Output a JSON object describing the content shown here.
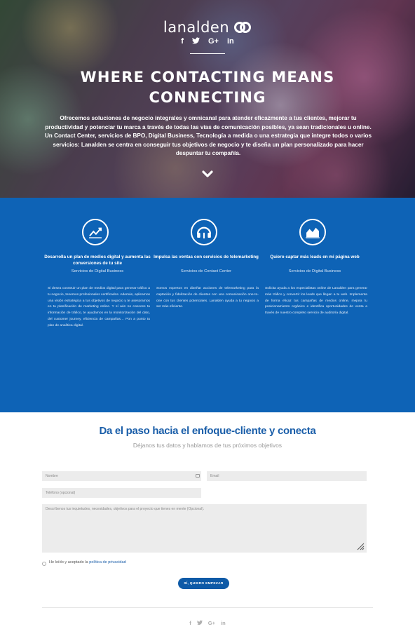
{
  "brand": {
    "name": "lanalden",
    "logo_icon": "double-ring-logo"
  },
  "hero": {
    "social": [
      "f",
      "🐦",
      "G+",
      "in"
    ],
    "title": "WHERE CONTACTING MEANS CONNECTING",
    "description": "Ofrecemos soluciones de negocio integrales y omnicanal para atender eficazmente a tus clientes, mejorar tu productividad y potenciar tu marca a través de todas las vías de comunicación posibles, ya sean tradicionales u online. Un Contact Center, servicios de BPO, Digital Business, Tecnología a medida o una estrategia que integre todos o varios servicios: Lanalden se centra en conseguir tus objetivos de negocio y te diseña un plan personalizado para hacer despuntar tu compañía."
  },
  "services": [
    {
      "icon": "chart-up-icon",
      "title": "Desarrolla un plan de medios digital y aumenta las conversiones de tu site",
      "subtitle": "Servicios de Digital Business",
      "text": "Si desea construir un plan de medios digital para generar tráfico a tu negocio, tenemos profesionales certificados. Además, aplicamos una visión estratégica a tus objetivos de negocio y te asesoramos en tu planificación de marketing online. Y sí aún no conoces tu información de tráfico, te ayudamos en la monitorización del dato, del customer journey, eficiencia de campañas… Pon a punto tu plan de analítica digital."
    },
    {
      "icon": "headset-icon",
      "title": "Impulsa las ventas con servicios de telemarketing",
      "subtitle": "Servicios de Contact Center",
      "text": "Somos expertos en diseñar acciones de telemarketing para la captación y fidelización de clientes con una comunicación one-to-one con tus clientes potenciales. Lanalden ayuda a tu negocio a ser más eficiente."
    },
    {
      "icon": "area-chart-icon",
      "title": "Quiero captar más leads en mi página web",
      "subtitle": "Servicios de Digital Business",
      "text": "Solicita ayuda a los especialistas online de Lanalden para generar más tráfico y convertir los leads que llegan a tu web. Implementa de forma eficaz tus campañas de medios online, mejora tu posicionamiento orgánico e identifica oportunidades de venta a través de nuestro completo servicio de auditoría digital."
    }
  ],
  "form": {
    "title": "Da el paso hacia el enfoque-cliente y conecta",
    "subtitle": "Déjanos tus datos y hablamos de tus próximos objetivos",
    "name_placeholder": "Nombre",
    "email_placeholder": "Email",
    "phone_placeholder": "Teléfono (opcional)",
    "message_placeholder": "Descríbenos tus inquietudes, necesidades, objetivos para el proyecto que tienes en mente (Opcional).",
    "consent_text": "He leído y aceptado la ",
    "consent_link": "política de privacidad",
    "submit_label": "SÍ, QUIERO EMPEZAR"
  },
  "footer": {
    "social": [
      "f",
      "🐦",
      "G+",
      "in"
    ]
  }
}
